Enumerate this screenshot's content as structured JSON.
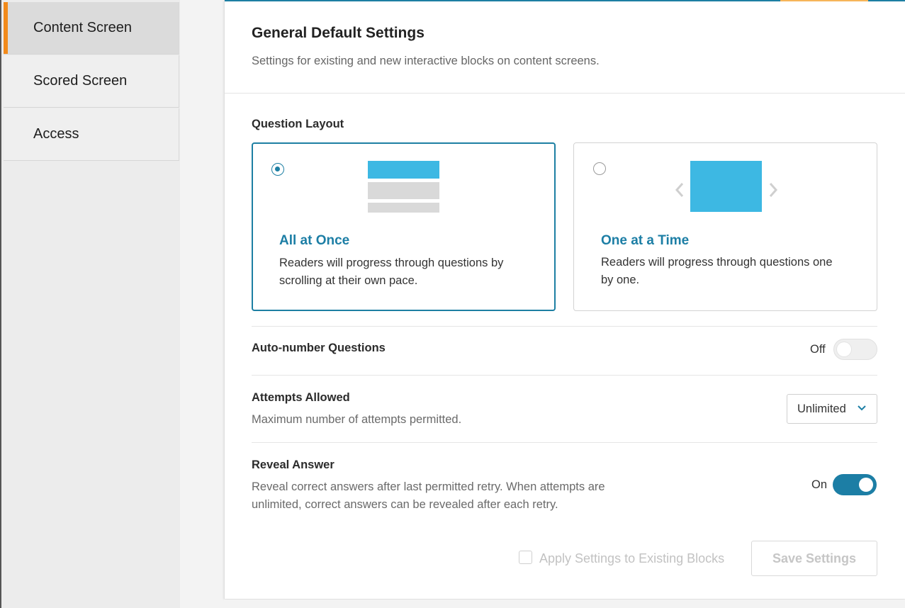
{
  "sidebar": {
    "items": [
      {
        "label": "Content Screen",
        "active": true
      },
      {
        "label": "Scored Screen",
        "active": false
      },
      {
        "label": "Access",
        "active": false
      }
    ]
  },
  "header": {
    "title": "General Default Settings",
    "subtitle": "Settings for existing and new interactive blocks on content screens."
  },
  "question_layout": {
    "label": "Question Layout",
    "options": [
      {
        "title": "All at Once",
        "desc_line1": "Readers will progress through questions by",
        "desc_line2": "scrolling at their own pace.",
        "selected": true,
        "icon": "stacked-layout-icon"
      },
      {
        "title": "One at a Time",
        "desc_line1": "Readers will progress through questions one",
        "desc_line2": "by one.",
        "selected": false,
        "icon": "carousel-layout-icon"
      }
    ]
  },
  "auto_number": {
    "label": "Auto-number Questions",
    "state_label": "Off",
    "on": false
  },
  "attempts": {
    "label": "Attempts Allowed",
    "description": "Maximum number of attempts permitted.",
    "selected": "Unlimited"
  },
  "reveal_answer": {
    "label": "Reveal Answer",
    "desc_line1": "Reveal correct answers after last permitted retry. When attempts are",
    "desc_line2": "unlimited, correct answers can be revealed after each retry.",
    "state_label": "On",
    "on": true
  },
  "footer": {
    "apply_label": "Apply Settings to Existing Blocks",
    "apply_checked": false,
    "save_label": "Save Settings"
  },
  "colors": {
    "accent": "#1c7ea5",
    "nav_accent": "#f28a1a",
    "illustration_blue": "#3db8e3"
  }
}
